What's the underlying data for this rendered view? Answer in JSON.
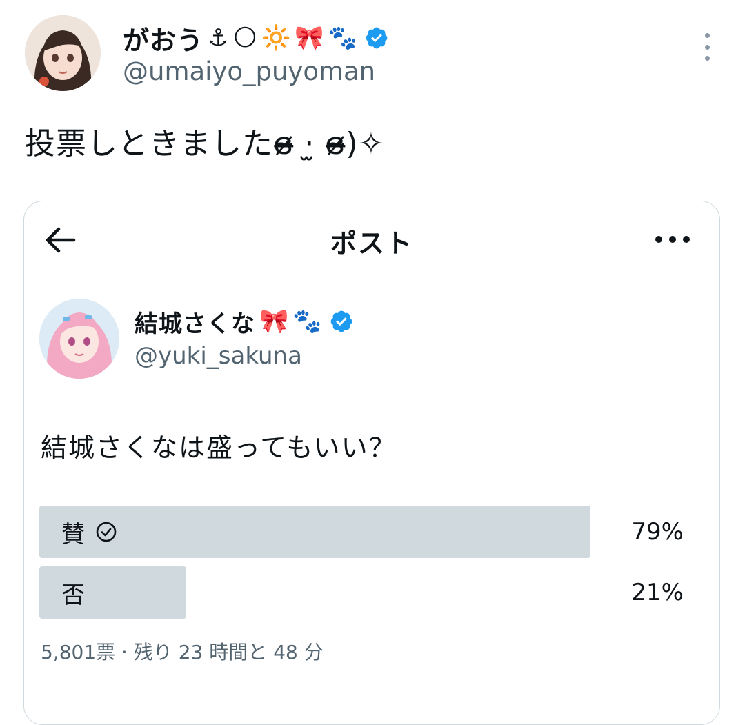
{
  "author": {
    "display_name": "がおう",
    "emojis": [
      "⚓",
      "🌕",
      "🔆",
      "🎀",
      "🐾"
    ],
    "handle": "@umaiyo_puyoman"
  },
  "tweet": {
    "text": "投票しときましたɞ̴̶̷ ·̫ ɞ̴̶̷)✧"
  },
  "quoted_screenshot": {
    "header": {
      "title": "ポスト"
    },
    "author": {
      "display_name": "結城さくな",
      "emojis": [
        "🎀",
        "🐾"
      ],
      "handle": "@yuki_sakuna"
    },
    "question": "結城さくなは盛ってもいい？",
    "poll": {
      "options": [
        {
          "label": "賛",
          "percent": "79%",
          "share": 0.79,
          "selected": true
        },
        {
          "label": "否",
          "percent": "21%",
          "share": 0.21,
          "selected": false
        }
      ],
      "footer": "5,801票 · 残り 23 時間と 48 分"
    }
  },
  "colors": {
    "verified_badge": "#1d9bf0",
    "poll_bar": "#cfd9de",
    "secondary_text": "#536471"
  },
  "icons": [
    "avatar",
    "verified-badge-icon",
    "more-vertical-icon",
    "back-arrow-icon",
    "more-horizontal-icon",
    "check-circle-icon"
  ]
}
